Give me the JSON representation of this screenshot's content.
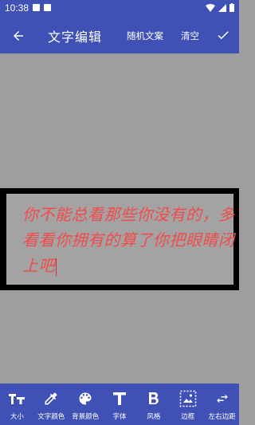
{
  "status_bar": {
    "time": "10:38"
  },
  "toolbar": {
    "title": "文字编辑",
    "random_label": "随机文案",
    "clear_label": "清空"
  },
  "text_box": {
    "text": "你不能总看那些你没有的，多看看你拥有的算了你把眼睛闭上吧",
    "text_color": "#f24b4b",
    "background_color": "#a3a3a3",
    "border_color": "#000000"
  },
  "bottom_tools": [
    {
      "label": "大小",
      "icon": "text-size-icon"
    },
    {
      "label": "文字颜色",
      "icon": "eyedropper-icon"
    },
    {
      "label": "背景颜色",
      "icon": "palette-icon"
    },
    {
      "label": "字体",
      "icon": "font-t-icon"
    },
    {
      "label": "风格",
      "icon": "bold-icon"
    },
    {
      "label": "边框",
      "icon": "border-image-icon"
    },
    {
      "label": "左右边距",
      "icon": "swap-horizontal-icon"
    }
  ],
  "colors": {
    "primary": "#3f51b5",
    "canvas": "#9e9e9e"
  }
}
